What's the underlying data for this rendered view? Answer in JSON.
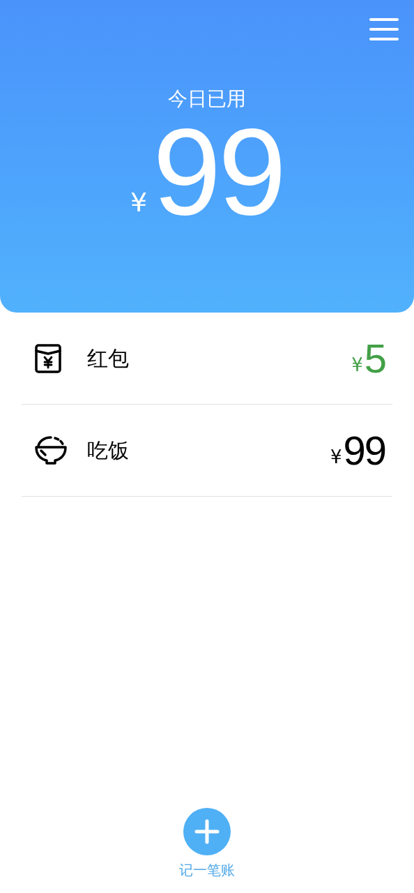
{
  "header": {
    "title": "今日已用",
    "currency": "¥",
    "amount": "99"
  },
  "entries": [
    {
      "kind": "envelope",
      "label": "红包",
      "currency": "¥",
      "amount": "5",
      "color": "#43a047"
    },
    {
      "kind": "bowl",
      "label": "吃饭",
      "currency": "¥",
      "amount": "99",
      "color": "#000000"
    }
  ],
  "add_button": {
    "label": "记一笔账"
  }
}
